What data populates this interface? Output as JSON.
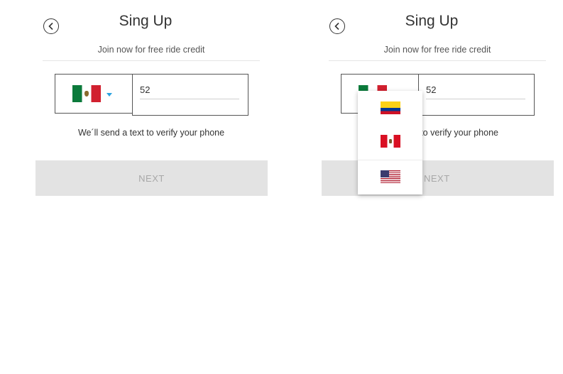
{
  "screens": [
    {
      "title": "Sing Up",
      "subtitle": "Join now for free ride credit",
      "selected_country": "mexico-flag-icon",
      "phone_value": "52",
      "helper_text": "We´ll send a text to verify your phone",
      "next_label": "NEXT",
      "dropdown_open": false
    },
    {
      "title": "Sing Up",
      "subtitle": "Join now for free ride credit",
      "selected_country": "mexico-flag-icon",
      "phone_value": "52",
      "helper_text": "xt to verify your phone",
      "next_label": "NEXT",
      "dropdown_open": true,
      "dropdown_options": [
        "colombia-flag-icon",
        "peru-flag-icon",
        "usa-flag-icon"
      ]
    }
  ],
  "colors": {
    "caret": "#2ba3e0",
    "next_button_bg": "#e3e3e3",
    "next_button_text": "#a8a8a8"
  }
}
